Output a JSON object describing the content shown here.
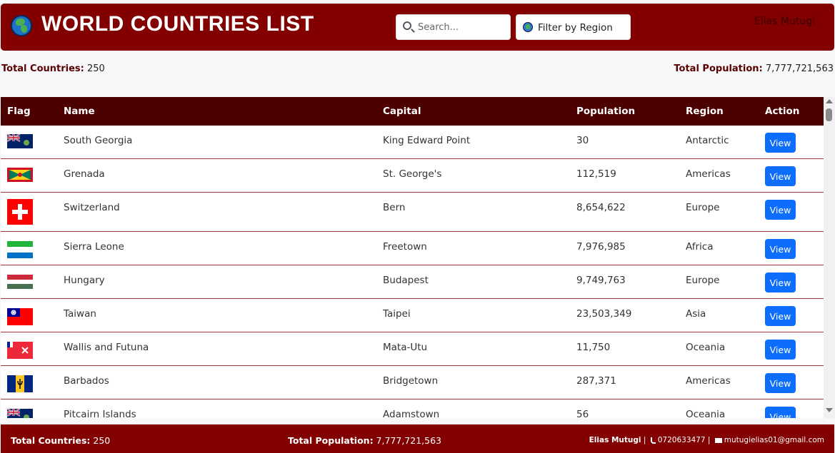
{
  "header": {
    "title": "WORLD COUNTRIES LIST",
    "search_placeholder": "Search...",
    "filter_label": "Filter by Region",
    "author": "Elias Mutugi"
  },
  "stats": {
    "countries_label": "Total Countries:",
    "countries_value": "250",
    "population_label": "Total Population:",
    "population_value": "7,777,721,563"
  },
  "table": {
    "columns": [
      "Flag",
      "Name",
      "Capital",
      "Population",
      "Region",
      "Action"
    ],
    "rows": [
      {
        "name": "South Georgia",
        "capital": "King Edward Point",
        "population": "30",
        "region": "Antarctic",
        "action": "View",
        "flag": "uk-ensign-blue"
      },
      {
        "name": "Grenada",
        "capital": "St. George's",
        "population": "112,519",
        "region": "Americas",
        "action": "View",
        "flag": "grenada"
      },
      {
        "name": "Switzerland",
        "capital": "Bern",
        "population": "8,654,622",
        "region": "Europe",
        "action": "View",
        "flag": "switzerland"
      },
      {
        "name": "Sierra Leone",
        "capital": "Freetown",
        "population": "7,976,985",
        "region": "Africa",
        "action": "View",
        "flag": "sierra-leone"
      },
      {
        "name": "Hungary",
        "capital": "Budapest",
        "population": "9,749,763",
        "region": "Europe",
        "action": "View",
        "flag": "hungary"
      },
      {
        "name": "Taiwan",
        "capital": "Taipei",
        "population": "23,503,349",
        "region": "Asia",
        "action": "View",
        "flag": "taiwan"
      },
      {
        "name": "Wallis and Futuna",
        "capital": "Mata-Utu",
        "population": "11,750",
        "region": "Oceania",
        "action": "View",
        "flag": "wallis-futuna"
      },
      {
        "name": "Barbados",
        "capital": "Bridgetown",
        "population": "287,371",
        "region": "Americas",
        "action": "View",
        "flag": "barbados"
      },
      {
        "name": "Pitcairn Islands",
        "capital": "Adamstown",
        "population": "56",
        "region": "Oceania",
        "action": "View",
        "flag": "uk-ensign-blue"
      }
    ]
  },
  "footer": {
    "countries_label": "Total Countries:",
    "countries_value": "250",
    "population_label": "Total Population:",
    "population_value": "7,777,721,563",
    "author": "Elias Mutugi",
    "phone": "0720633477",
    "email": "mutugielias01@gmail.com"
  },
  "colors": {
    "header_bg": "#820000",
    "table_header_bg": "#4d0000",
    "button": "#0d6efd"
  }
}
